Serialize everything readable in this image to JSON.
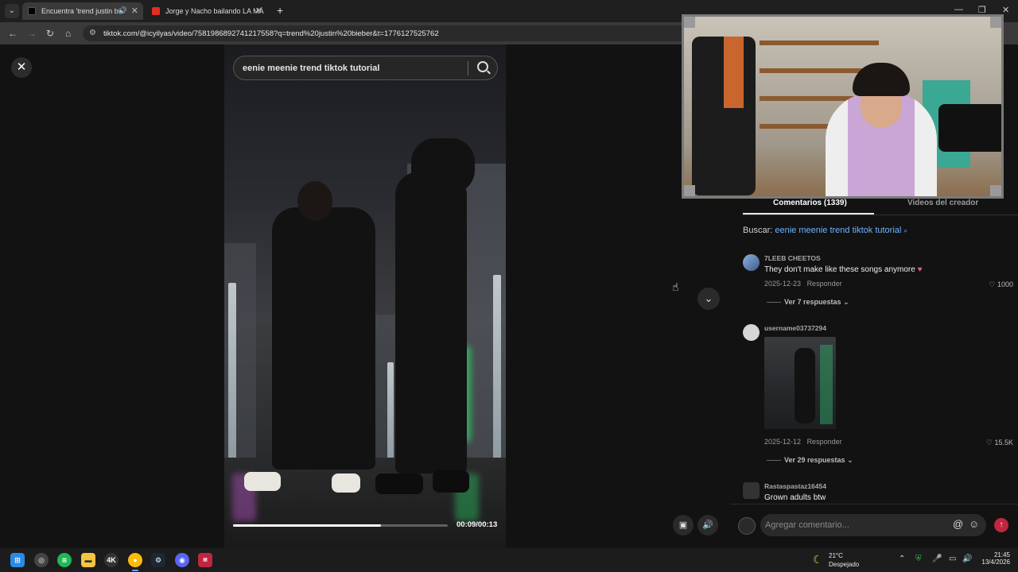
{
  "browser": {
    "tabs": [
      {
        "title": "Encuentra 'trend justin bie",
        "active": true,
        "icon": "tiktok-icon"
      },
      {
        "title": "Jorge y Nacho bailando LA MÁ",
        "active": false,
        "icon": "youtube-icon"
      }
    ],
    "url": "tiktok.com/@icyilyas/video/7581986892741217558?q=trend%20justin%20bieber&t=1776127525762"
  },
  "video": {
    "search_text": "eenie meenie trend tiktok tutorial",
    "time": "00:09/00:13",
    "progress": 0.69
  },
  "comments": {
    "tab_comments": "Comentarios (1339)",
    "tab_creator": "Videos del creador",
    "buscar_label": "Buscar:",
    "buscar_query": "eenie meenie trend tiktok tutorial",
    "items": [
      {
        "user": "7LEEB CHEETOS",
        "text": "They don't make like these songs anymore",
        "date": "2025-12-23",
        "reply": "Responder",
        "likes": "1000",
        "replies": "Ver 7 respuestas"
      },
      {
        "user": "username03737294",
        "text": "",
        "date": "2025-12-12",
        "reply": "Responder",
        "likes": "15.5K",
        "replies": "Ver 29 respuestas"
      },
      {
        "user": "Rastaspastaz16454",
        "text": "Grown adults btw"
      }
    ],
    "compose_placeholder": "Agregar comentario..."
  },
  "taskbar": {
    "temp": "21°C",
    "weather": "Despejado",
    "time": "21:45",
    "date": "13/4/2026"
  }
}
